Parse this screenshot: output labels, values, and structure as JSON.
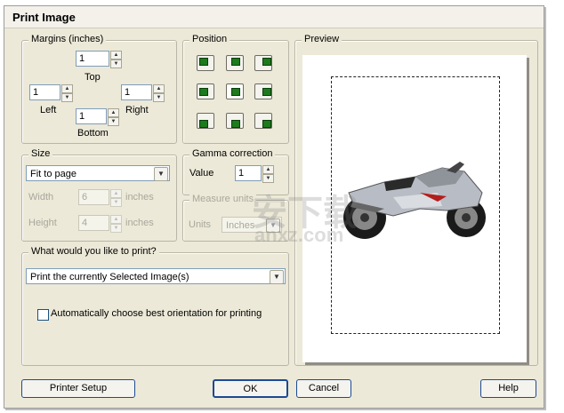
{
  "dialog": {
    "title": "Print Image"
  },
  "margins": {
    "legend": "Margins (inches)",
    "top_value": "1",
    "top_label": "Top",
    "left_value": "1",
    "left_label": "Left",
    "right_value": "1",
    "right_label": "Right",
    "bottom_value": "1",
    "bottom_label": "Bottom"
  },
  "position": {
    "legend": "Position",
    "buttons": [
      "top-left",
      "top-center",
      "top-right",
      "middle-left",
      "center",
      "middle-right",
      "bottom-left",
      "bottom-center",
      "bottom-right"
    ],
    "selected": "center"
  },
  "size": {
    "legend": "Size",
    "mode": "Fit to page",
    "width_label": "Width",
    "width_value": "6",
    "width_unit": "inches",
    "height_label": "Height",
    "height_value": "4",
    "height_unit": "inches"
  },
  "gamma": {
    "legend": "Gamma correction",
    "value_label": "Value",
    "value": "1"
  },
  "measure": {
    "legend": "Measure units",
    "units_label": "Units",
    "units_value": "Inches"
  },
  "print_what": {
    "legend": "What would you like to print?",
    "selection": "Print the currently Selected Image(s)",
    "auto_orient_label": "Automatically choose best orientation for printing",
    "auto_orient_checked": false
  },
  "preview": {
    "legend": "Preview"
  },
  "buttons": {
    "printer_setup": "Printer Setup",
    "ok": "OK",
    "cancel": "Cancel",
    "help": "Help"
  },
  "watermark": {
    "main": "安下载",
    "sub": "anxz.com"
  }
}
